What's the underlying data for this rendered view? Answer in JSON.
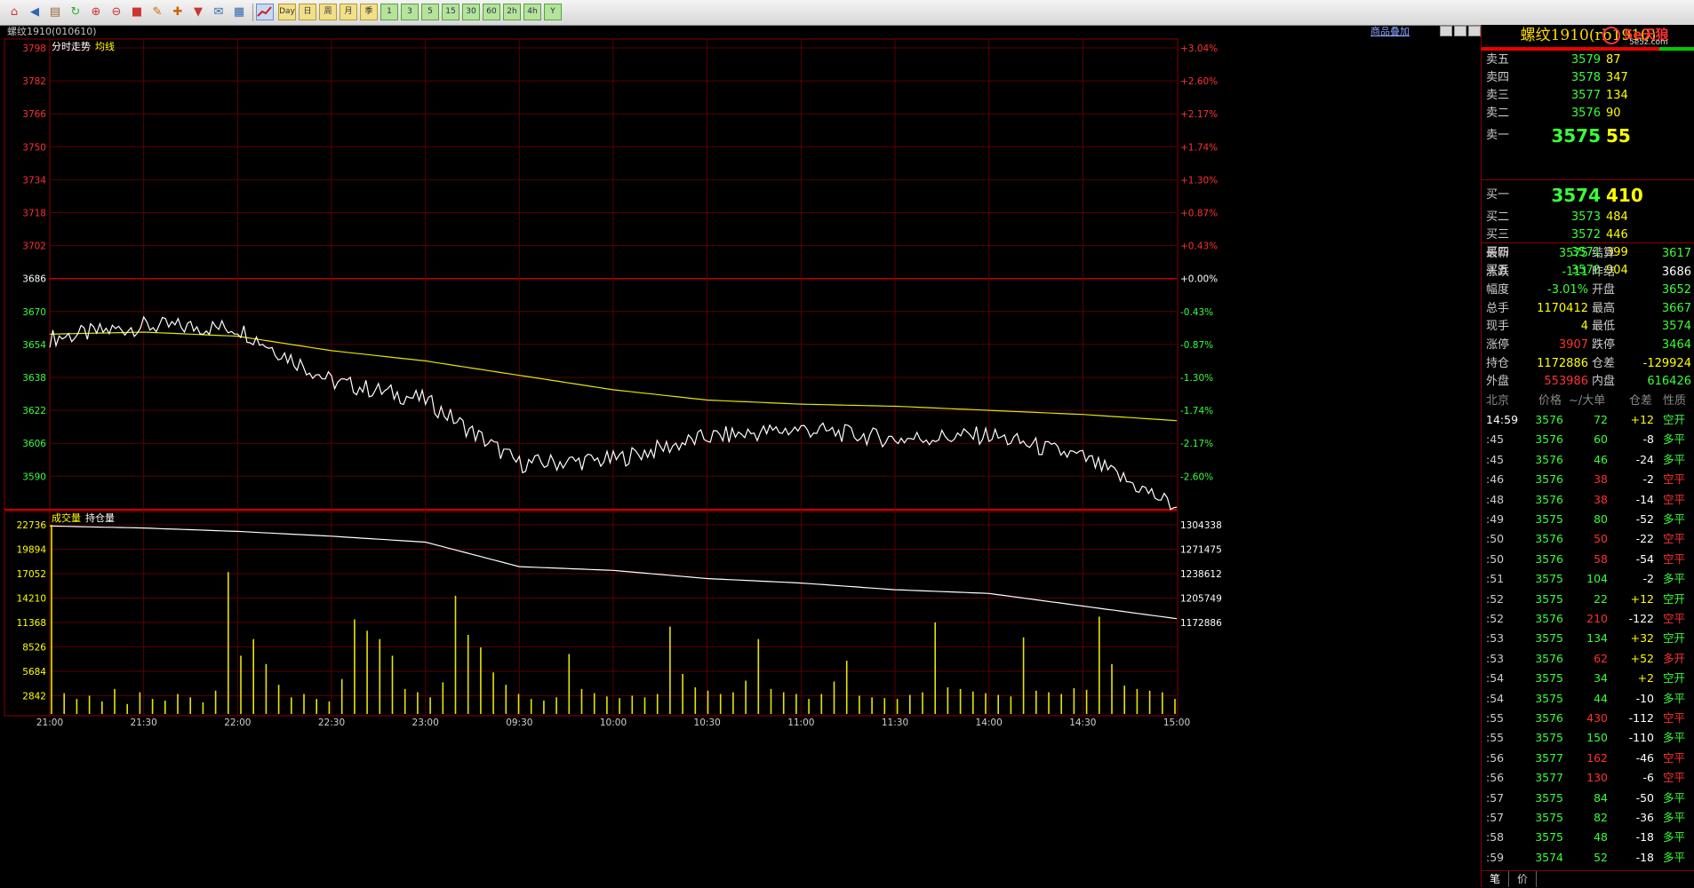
{
  "toolbar": {
    "icons": [
      "home-icon",
      "back-icon",
      "open-icon",
      "refresh-icon",
      "zoom-in-icon",
      "zoom-out-icon",
      "stop-icon",
      "draw-icon",
      "tools-icon",
      "filter-icon",
      "news-icon",
      "grid-icon"
    ],
    "period_buttons": [
      "Day",
      "日",
      "周",
      "月",
      "季",
      "1",
      "3",
      "5",
      "15",
      "30",
      "60",
      "2h",
      "4h",
      "Y"
    ]
  },
  "chart": {
    "title": "螺纹1910(010610)",
    "price_legend": [
      "分时走势",
      "均线"
    ],
    "volume_legend": [
      "成交量",
      "持仓量"
    ],
    "overlay_link": "商品叠加",
    "colors": {
      "price_line": "#ffffff",
      "avg_line": "#e6e600",
      "volume": "#e6e600",
      "grid": "#8b0000",
      "up": "#ff3030",
      "down": "#39ff39"
    },
    "price_ticks": [
      "3798",
      "3782",
      "3766",
      "3750",
      "3734",
      "3718",
      "3702",
      "3686",
      "3670",
      "3654",
      "3638",
      "3622",
      "3606",
      "3590"
    ],
    "pct_ticks": [
      "+3.04%",
      "+2.60%",
      "+2.17%",
      "+1.74%",
      "+1.30%",
      "+0.87%",
      "+0.43%",
      "+0.00%",
      "-0.43%",
      "-0.87%",
      "-1.30%",
      "-1.74%",
      "-2.17%",
      "-2.60%"
    ],
    "vol_ticks": [
      "22736",
      "19894",
      "17052",
      "14210",
      "11368",
      "8526",
      "5684",
      "2842"
    ],
    "oi_ticks": [
      "1304338",
      "1271475",
      "1238612",
      "1205749",
      "1172886"
    ],
    "time_ticks": [
      "21:00",
      "21:30",
      "22:00",
      "22:30",
      "23:00",
      "09:30",
      "10:00",
      "10:30",
      "11:00",
      "11:30",
      "14:00",
      "14:30",
      "15:00"
    ]
  },
  "chart_data": {
    "type": "line",
    "x": [
      "21:00",
      "21:30",
      "22:00",
      "22:30",
      "23:00",
      "09:30",
      "10:00",
      "10:30",
      "11:00",
      "11:30",
      "14:00",
      "14:30",
      "15:00"
    ],
    "prev_settle": 3686,
    "series": [
      {
        "name": "分时走势",
        "values": [
          3657,
          3663,
          3662,
          3636,
          3627,
          3596,
          3598,
          3609,
          3613,
          3608,
          3610,
          3599,
          3575
        ]
      },
      {
        "name": "均线",
        "values": [
          3659,
          3660,
          3658,
          3651,
          3646,
          3639,
          3632,
          3627,
          3625,
          3624,
          3622,
          3620,
          3617
        ]
      },
      {
        "name": "持仓量",
        "values": [
          1302800,
          1300000,
          1295500,
          1289000,
          1281000,
          1248000,
          1243000,
          1232000,
          1226000,
          1217000,
          1212000,
          1195000,
          1178000
        ]
      }
    ],
    "volume": [
      22736,
      2500,
      1800,
      2200,
      1500,
      3000,
      1200,
      2600,
      1800,
      1600,
      2400,
      2000,
      1400,
      2800,
      17052,
      7000,
      9000,
      6000,
      3500,
      2000,
      2400,
      1800,
      1500,
      4200,
      11368,
      10000,
      9000,
      7000,
      3000,
      2600,
      2000,
      3800,
      14210,
      9500,
      8000,
      5000,
      3500,
      2400,
      1800,
      1600,
      2000,
      7200,
      3000,
      2500,
      2100,
      1900,
      2200,
      2000,
      2400,
      10500,
      4800,
      3200,
      2800,
      2400,
      2600,
      4000,
      9000,
      3000,
      2600,
      2400,
      1800,
      2400,
      3900,
      6400,
      2200,
      2000,
      1900,
      1800,
      2300,
      2600,
      11000,
      3200,
      3000,
      2700,
      2500,
      2300,
      2100,
      9200,
      2800,
      2600,
      2400,
      3100,
      2900,
      11700,
      6000,
      3400,
      3000,
      2800,
      2600,
      1800
    ],
    "ylim": [
      3582,
      3798
    ],
    "volume_max": 22736
  },
  "quote": {
    "title": "螺纹1910(rb1910)",
    "logo": "5e天狼",
    "logo_sub": "5e5z.com",
    "ask": [
      {
        "label": "卖五",
        "price": "3579",
        "vol": "87"
      },
      {
        "label": "卖四",
        "price": "3578",
        "vol": "347"
      },
      {
        "label": "卖三",
        "price": "3577",
        "vol": "134"
      },
      {
        "label": "卖二",
        "price": "3576",
        "vol": "90"
      },
      {
        "label": "卖一",
        "price": "3575",
        "vol": "55"
      }
    ],
    "bid": [
      {
        "label": "买一",
        "price": "3574",
        "vol": "410"
      },
      {
        "label": "买二",
        "price": "3573",
        "vol": "484"
      },
      {
        "label": "买三",
        "price": "3572",
        "vol": "446"
      },
      {
        "label": "买四",
        "price": "3571",
        "vol": "399"
      },
      {
        "label": "买五",
        "price": "3570",
        "vol": "904"
      }
    ],
    "stats": [
      {
        "l1": "最新",
        "v1": "3575",
        "c1": "#39ff39",
        "l2": "结算",
        "v2": "3617",
        "c2": "#39ff39"
      },
      {
        "l1": "涨跌",
        "v1": "-111",
        "c1": "#39ff39",
        "l2": "昨结",
        "v2": "3686",
        "c2": "#ffffff"
      },
      {
        "l1": "幅度",
        "v1": "-3.01%",
        "c1": "#39ff39",
        "l2": "开盘",
        "v2": "3652",
        "c2": "#39ff39"
      },
      {
        "l1": "总手",
        "v1": "1170412",
        "c1": "#ffff00",
        "l2": "最高",
        "v2": "3667",
        "c2": "#39ff39"
      },
      {
        "l1": "现手",
        "v1": "4",
        "c1": "#ffff00",
        "l2": "最低",
        "v2": "3574",
        "c2": "#39ff39"
      },
      {
        "l1": "涨停",
        "v1": "3907",
        "c1": "#ff3030",
        "l2": "跌停",
        "v2": "3464",
        "c2": "#39ff39"
      },
      {
        "l1": "持仓",
        "v1": "1172886",
        "c1": "#ffff00",
        "l2": "仓差",
        "v2": "-129924",
        "c2": "#ffff00"
      },
      {
        "l1": "外盘",
        "v1": "553986",
        "c1": "#ff3030",
        "l2": "内盘",
        "v2": "616426",
        "c2": "#39ff39"
      }
    ],
    "tick_header": {
      "time": "北京",
      "price": "价格",
      "vol": "~/大单",
      "diff": "仓差",
      "nature": "性质"
    },
    "ticks": [
      {
        "t": "14:59",
        "p": "3576",
        "v": "72",
        "d": "+12",
        "n": "空开",
        "vc": "#39ff39",
        "nc": "#39ff39"
      },
      {
        "t": ":45",
        "p": "3576",
        "v": "60",
        "d": "-8",
        "n": "多平",
        "vc": "#39ff39",
        "nc": "#39ff39"
      },
      {
        "t": ":45",
        "p": "3576",
        "v": "46",
        "d": "-24",
        "n": "多平",
        "vc": "#39ff39",
        "nc": "#39ff39"
      },
      {
        "t": ":46",
        "p": "3576",
        "v": "38",
        "d": "-2",
        "n": "空平",
        "vc": "#ff3030",
        "nc": "#ff3030"
      },
      {
        "t": ":48",
        "p": "3576",
        "v": "38",
        "d": "-14",
        "n": "空平",
        "vc": "#ff3030",
        "nc": "#ff3030"
      },
      {
        "t": ":49",
        "p": "3575",
        "v": "80",
        "d": "-52",
        "n": "多平",
        "vc": "#39ff39",
        "nc": "#39ff39"
      },
      {
        "t": ":50",
        "p": "3576",
        "v": "50",
        "d": "-22",
        "n": "空平",
        "vc": "#ff3030",
        "nc": "#ff3030"
      },
      {
        "t": ":50",
        "p": "3576",
        "v": "58",
        "d": "-54",
        "n": "空平",
        "vc": "#ff3030",
        "nc": "#ff3030"
      },
      {
        "t": ":51",
        "p": "3575",
        "v": "104",
        "d": "-2",
        "n": "多平",
        "vc": "#39ff39",
        "nc": "#39ff39"
      },
      {
        "t": ":52",
        "p": "3575",
        "v": "22",
        "d": "+12",
        "n": "空开",
        "vc": "#39ff39",
        "nc": "#39ff39"
      },
      {
        "t": ":52",
        "p": "3576",
        "v": "210",
        "d": "-122",
        "n": "空平",
        "vc": "#ff3030",
        "nc": "#ff3030"
      },
      {
        "t": ":53",
        "p": "3575",
        "v": "134",
        "d": "+32",
        "n": "空开",
        "vc": "#39ff39",
        "nc": "#39ff39"
      },
      {
        "t": ":53",
        "p": "3576",
        "v": "62",
        "d": "+52",
        "n": "多开",
        "vc": "#ff3030",
        "nc": "#ff3030"
      },
      {
        "t": ":54",
        "p": "3575",
        "v": "34",
        "d": "+2",
        "n": "空开",
        "vc": "#39ff39",
        "nc": "#39ff39"
      },
      {
        "t": ":54",
        "p": "3575",
        "v": "44",
        "d": "-10",
        "n": "多平",
        "vc": "#39ff39",
        "nc": "#39ff39"
      },
      {
        "t": ":55",
        "p": "3576",
        "v": "430",
        "d": "-112",
        "n": "空平",
        "vc": "#ff3030",
        "nc": "#ff3030"
      },
      {
        "t": ":55",
        "p": "3575",
        "v": "150",
        "d": "-110",
        "n": "多平",
        "vc": "#39ff39",
        "nc": "#39ff39"
      },
      {
        "t": ":56",
        "p": "3577",
        "v": "162",
        "d": "-46",
        "n": "空平",
        "vc": "#ff3030",
        "nc": "#ff3030"
      },
      {
        "t": ":56",
        "p": "3577",
        "v": "130",
        "d": "-6",
        "n": "空平",
        "vc": "#ff3030",
        "nc": "#ff3030"
      },
      {
        "t": ":57",
        "p": "3575",
        "v": "84",
        "d": "-50",
        "n": "多平",
        "vc": "#39ff39",
        "nc": "#39ff39"
      },
      {
        "t": ":57",
        "p": "3575",
        "v": "82",
        "d": "-36",
        "n": "多平",
        "vc": "#39ff39",
        "nc": "#39ff39"
      },
      {
        "t": ":58",
        "p": "3575",
        "v": "48",
        "d": "-18",
        "n": "多平",
        "vc": "#39ff39",
        "nc": "#39ff39"
      },
      {
        "t": ":59",
        "p": "3574",
        "v": "52",
        "d": "-18",
        "n": "多平",
        "vc": "#39ff39",
        "nc": "#39ff39"
      }
    ],
    "tabs": [
      "笔",
      "价"
    ]
  }
}
